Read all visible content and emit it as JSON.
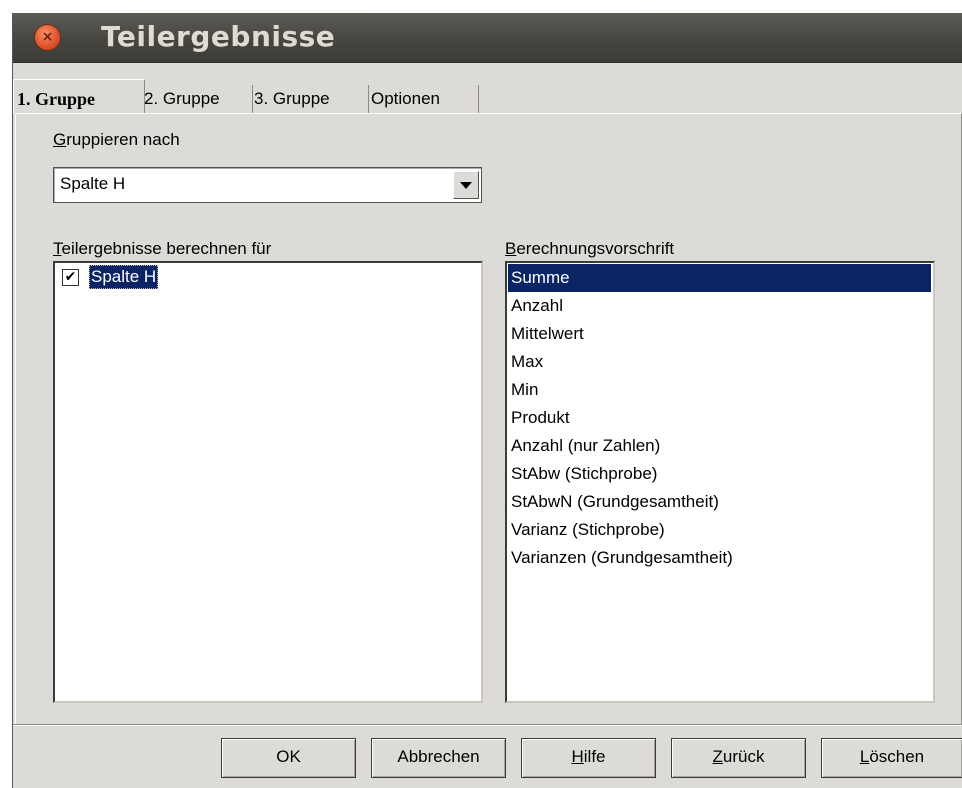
{
  "window": {
    "title": "Teilergebnisse",
    "close_symbol": "×"
  },
  "tabs": [
    {
      "label": "1. Gruppe",
      "active": true
    },
    {
      "label": "2. Gruppe",
      "active": false
    },
    {
      "label": "3. Gruppe",
      "active": false
    },
    {
      "label": "Optionen",
      "active": false
    }
  ],
  "group_by": {
    "label_mnemonic": "G",
    "label_rest": "ruppieren nach",
    "value": "Spalte H"
  },
  "calc_for": {
    "label_mnemonic": "T",
    "label_rest": "eilergebnisse berechnen für",
    "items": [
      {
        "label": "Spalte H",
        "checked": true,
        "checkmark": "✔"
      }
    ]
  },
  "functions": {
    "label_mnemonic": "B",
    "label_rest": "erechnungsvorschrift",
    "items": [
      "Summe",
      "Anzahl",
      "Mittelwert",
      "Max",
      "Min",
      "Produkt",
      "Anzahl (nur Zahlen)",
      "StAbw (Stichprobe)",
      "StAbwN (Grundgesamtheit)",
      "Varianz (Stichprobe)",
      "Varianzen (Grundgesamtheit)"
    ],
    "selected_index": 0
  },
  "buttons": {
    "ok": "OK",
    "cancel": "Abbrechen",
    "help_mnemonic": "H",
    "help_rest": "ilfe",
    "back_mnemonic": "Z",
    "back_rest": "urück",
    "delete_mnemonic": "L",
    "delete_rest": "öschen"
  },
  "colors": {
    "selection": "#0a2466",
    "dialog_bg": "#dddbd7",
    "titlebar": "#47453f"
  }
}
